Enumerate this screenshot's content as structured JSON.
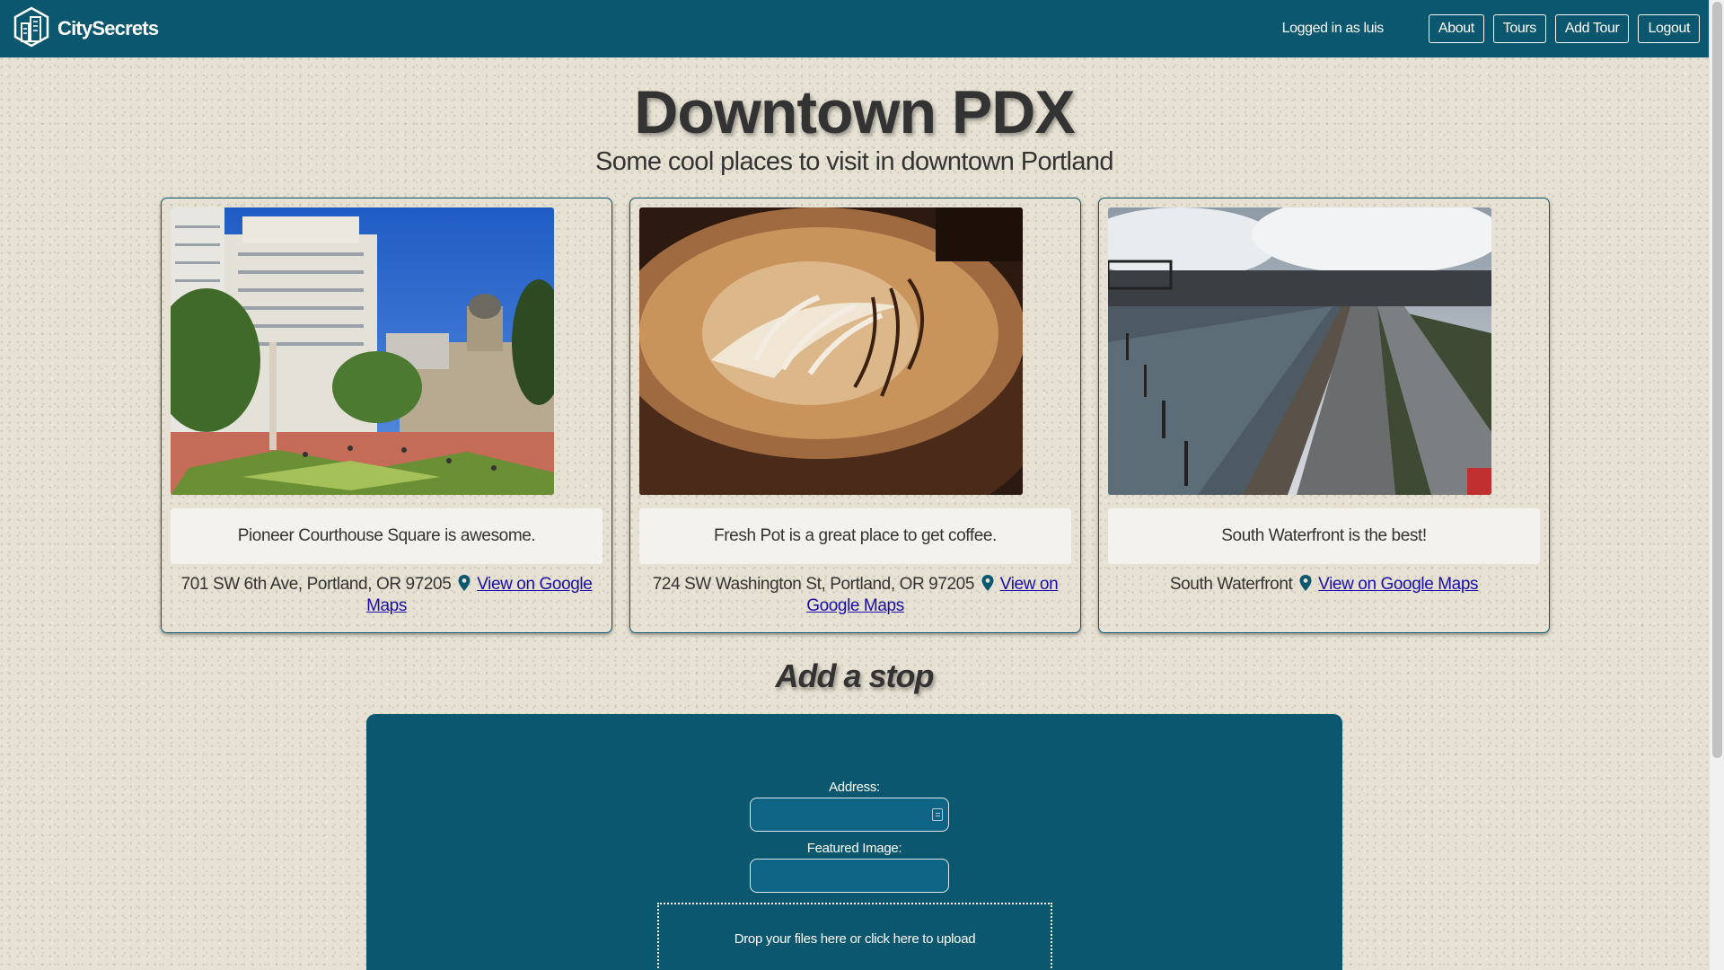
{
  "app": {
    "brand": "CitySecrets",
    "logo_icon": "city-buildings-hexagon-icon",
    "colors": {
      "nav": "#0b5770",
      "panel": "#0b5770",
      "background": "#e6e1d2",
      "link": "#1a0dab"
    }
  },
  "nav": {
    "logged_in": "Logged in as luis",
    "buttons": [
      "About",
      "Tours",
      "Add Tour",
      "Logout"
    ]
  },
  "tour": {
    "title": "Downtown PDX",
    "subtitle": "Some cool places to visit in downtown Portland"
  },
  "stops": [
    {
      "image": "plaza-with-buildings-photo",
      "description": "Pioneer Courthouse Square is awesome.",
      "address": "701 SW 6th Ave, Portland, OR 97205",
      "map_link": "View on Google Maps",
      "icon": "map-marker-icon"
    },
    {
      "image": "latte-art-photo",
      "description": "Fresh Pot is a great place to get coffee.",
      "address": "724 SW Washington St, Portland, OR 97205",
      "map_link": "View on Google Maps",
      "icon": "map-marker-icon"
    },
    {
      "image": "river-waterfront-photo",
      "description": "South Waterfront is the best!",
      "address": "South Waterfront",
      "map_link": "View on Google Maps",
      "icon": "map-marker-icon"
    }
  ],
  "add_stop": {
    "heading": "Add a stop",
    "address_label": "Address:",
    "address_value": "",
    "image_label": "Featured Image:",
    "image_value": "",
    "dropzone_text": "Drop your files here or click here to upload"
  }
}
